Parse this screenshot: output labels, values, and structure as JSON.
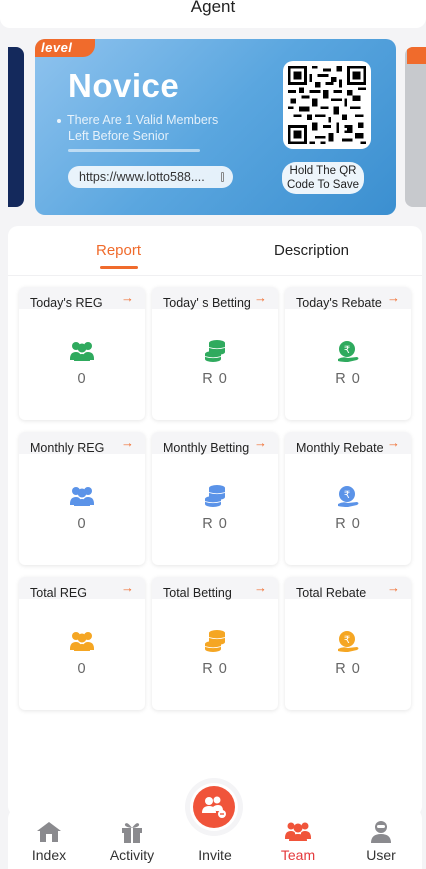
{
  "header": {
    "title": "Agent"
  },
  "level_card": {
    "tag": "level",
    "name": "Novice",
    "desc_line1": "There Are 1 Valid Members",
    "desc_line2": "Left Before Senior",
    "link": "https://www.lotto588....",
    "qr_hint": "Hold The QR Code To Save",
    "colors": {
      "card": "#5aa6df",
      "tag": "#f06b2c"
    }
  },
  "tabs": {
    "report": "Report",
    "description": "Description"
  },
  "stats": {
    "arrow": "→",
    "today_reg": {
      "label": "Today's REG",
      "value": "0",
      "icon": "users-icon",
      "color": "#2faa5e"
    },
    "today_betting": {
      "label": "Today' s Betting",
      "value": "R 0",
      "icon": "coins-icon",
      "color": "#2faa5e"
    },
    "today_rebate": {
      "label": "Today's Rebate",
      "value": "R 0",
      "icon": "rebate-icon",
      "color": "#2faa5e"
    },
    "monthly_reg": {
      "label": "Monthly REG",
      "value": "0",
      "icon": "users-icon",
      "color": "#5b93e8"
    },
    "monthly_betting": {
      "label": "Monthly Betting",
      "value": "R 0",
      "icon": "coins-icon",
      "color": "#5b93e8"
    },
    "monthly_rebate": {
      "label": "Monthly Rebate",
      "value": "R 0",
      "icon": "rebate-icon",
      "color": "#5b93e8"
    },
    "total_reg": {
      "label": "Total REG",
      "value": "0",
      "icon": "users-icon",
      "color": "#f5a623"
    },
    "total_betting": {
      "label": "Total Betting",
      "value": "R 0",
      "icon": "coins-icon",
      "color": "#f5a623"
    },
    "total_rebate": {
      "label": "Total Rebate",
      "value": "R 0",
      "icon": "rebate-icon",
      "color": "#f5a623"
    }
  },
  "nav": {
    "index": "Index",
    "activity": "Activity",
    "invite": "Invite",
    "team": "Team",
    "user": "User",
    "active": "Team",
    "active_color": "#e4393c"
  }
}
